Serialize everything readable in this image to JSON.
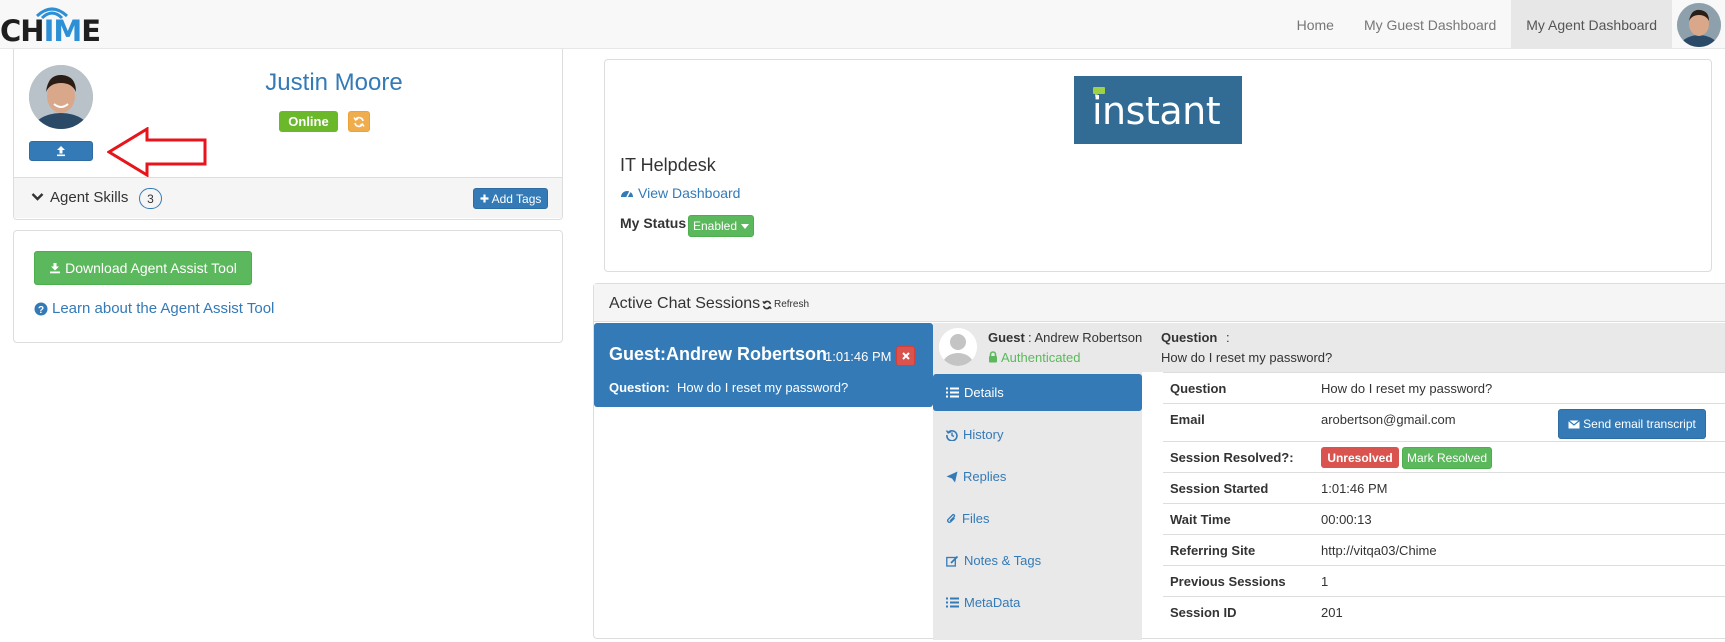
{
  "brand": {
    "logo_text_a": "CH",
    "logo_text_b": "IM",
    "logo_text_c": "E"
  },
  "nav": {
    "links": [
      {
        "label": "Home"
      },
      {
        "label": "My Guest Dashboard"
      },
      {
        "label": "My Agent Dashboard"
      }
    ]
  },
  "profile": {
    "name": "Justin Moore",
    "status": "Online",
    "skills_label": "Agent Skills",
    "skills_count": "3",
    "add_tags_label": "Add Tags"
  },
  "assist": {
    "download_label": "Download Agent Assist Tool",
    "learn_label": "Learn about the Agent Assist Tool"
  },
  "queue": {
    "logo_text": "instant",
    "name": "IT Helpdesk",
    "view_dashboard": "View Dashboard",
    "my_status_label": "My Status",
    "my_status_value": "Enabled"
  },
  "sessions": {
    "title": "Active Chat Sessions",
    "refresh_label": "Refresh",
    "card": {
      "guest_prefix": "Guest:",
      "guest_name": "Andrew Robertson",
      "time": "1:01:46 PM",
      "question_label": "Question:",
      "question": "How do I reset my password?"
    },
    "detail_header": {
      "guest_label": "Guest",
      "guest_name": ": Andrew Robertson",
      "auth": "Authenticated",
      "question_label": "Question",
      "question_colon": ":",
      "question": "How do I reset my password?"
    },
    "tabs": [
      {
        "label": "Details"
      },
      {
        "label": "History"
      },
      {
        "label": "Replies"
      },
      {
        "label": "Files"
      },
      {
        "label": "Notes & Tags"
      },
      {
        "label": "MetaData"
      }
    ],
    "details": {
      "question_k": "Question",
      "question_v": "How do I reset my password?",
      "email_k": "Email",
      "email_v": "arobertson@gmail.com",
      "send_transcript": "Send email transcript",
      "resolved_k": "Session Resolved?:",
      "resolved_badge": "Unresolved",
      "mark_resolved": "Mark Resolved",
      "started_k": "Session Started",
      "started_v": "1:01:46 PM",
      "wait_k": "Wait Time",
      "wait_v": "00:00:13",
      "site_k": "Referring Site",
      "site_v": "http://vitqa03/Chime",
      "prev_k": "Previous Sessions",
      "prev_v": "1",
      "id_k": "Session ID",
      "id_v": "201"
    }
  },
  "colors": {
    "primary": "#337ab7",
    "success": "#5cb85c",
    "danger": "#d9534f",
    "warning": "#f0ad4e",
    "online": "#6bb82b",
    "annotation_arrow": "#e8141b"
  }
}
